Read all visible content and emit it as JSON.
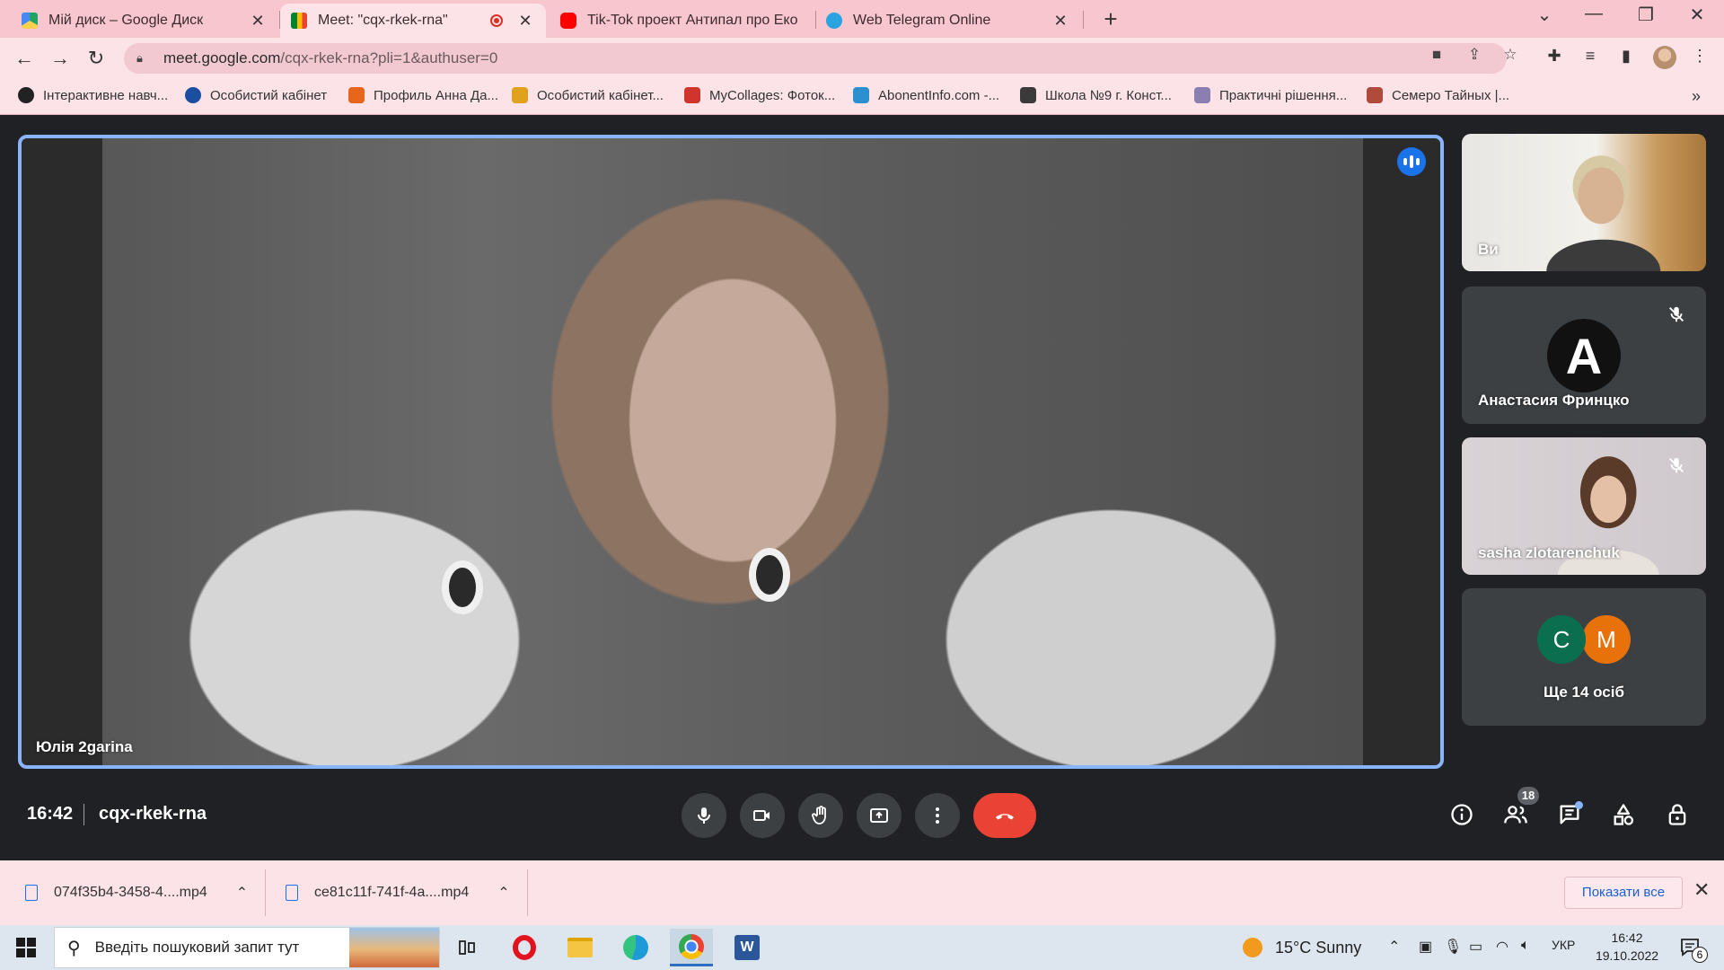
{
  "browser": {
    "tabs": [
      {
        "title": "Мій диск – Google Диск",
        "close": "✕",
        "icon": "google-drive-icon",
        "color": "#1fa463"
      },
      {
        "title": "Meet: \"cqx-rkek-rna\"",
        "close": "✕",
        "icon": "google-meet-icon",
        "color": "#00832d",
        "active": true,
        "recording": true
      },
      {
        "title": "Tik-Tok проект Антипал про Еко",
        "close": "",
        "icon": "youtube-icon",
        "color": "#ff0000"
      },
      {
        "title": "Web Telegram Online",
        "close": "✕",
        "icon": "telegram-icon",
        "color": "#2aa3e0"
      }
    ],
    "new_tab": "+",
    "window_controls": {
      "dropdown": "⌄",
      "minimize": "—",
      "maximize": "❐",
      "close": "✕"
    },
    "nav": {
      "back": "←",
      "forward": "→",
      "reload": "↻"
    },
    "address": {
      "host": "meet.google.com",
      "path": "/cqx-rkek-rna?pli=1&authuser=0"
    },
    "bookmarks": [
      {
        "label": "Інтерактивне навч...",
        "color": "#222"
      },
      {
        "label": "Особистий кабінет",
        "color": "#1a4fa0"
      },
      {
        "label": "Профиль Анна Да...",
        "color": "#e8661c"
      },
      {
        "label": "Особистий кабінет...",
        "color": "#e0a21c"
      },
      {
        "label": "MyCollages: Фоток...",
        "color": "#d0342c"
      },
      {
        "label": "AbonentInfo.com -...",
        "color": "#2c8fd0"
      },
      {
        "label": "Школа №9 г. Конст...",
        "color": "#3a3a3a"
      },
      {
        "label": "Практичні рішення...",
        "color": "#8a7fb0"
      },
      {
        "label": "Семеро Тайных |...",
        "color": "#b04a3a"
      }
    ],
    "bookmarks_more": "»"
  },
  "meet": {
    "main_participant": "Юлія 2garina",
    "participants": [
      {
        "name": "Ви"
      },
      {
        "name": "Анастасия Фринцко",
        "initial": "A",
        "muted": true
      },
      {
        "name": "sasha zlotarenchuk",
        "muted": true
      }
    ],
    "more": {
      "initials": [
        "C",
        "M"
      ],
      "colors": [
        "#0b6e4f",
        "#e8710a"
      ],
      "label": "Ще 14 осіб"
    },
    "time": "16:42",
    "code": "cqx-rkek-rna",
    "people_count": "18"
  },
  "downloads": {
    "items": [
      "074f35b4-3458-4....mp4",
      "ce81c11f-741f-4a....mp4"
    ],
    "show_all": "Показати все",
    "close": "✕"
  },
  "taskbar": {
    "search_placeholder": "Введіть пошуковий запит тут",
    "weather": "15°C  Sunny",
    "language": "УКР",
    "time": "16:42",
    "date": "19.10.2022",
    "notifications": "6"
  }
}
